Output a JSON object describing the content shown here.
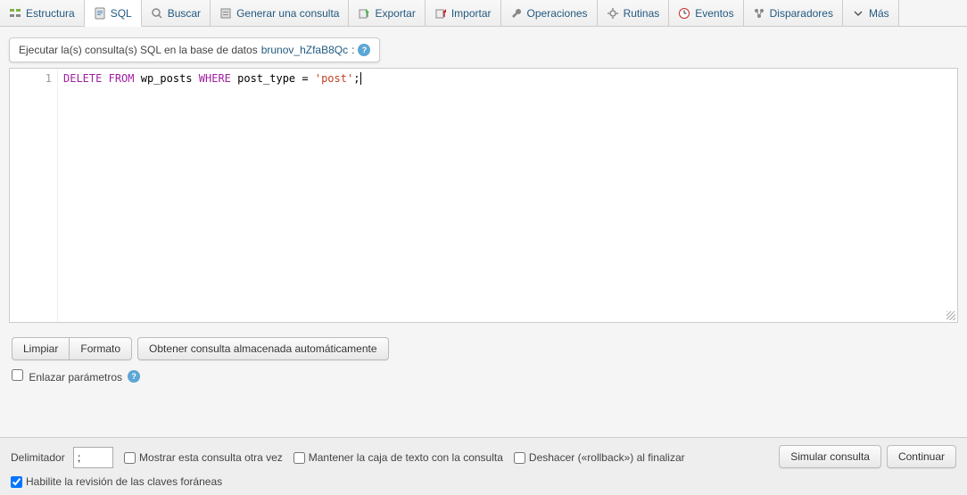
{
  "tabs": {
    "structure": "Estructura",
    "sql": "SQL",
    "search": "Buscar",
    "generate": "Generar una consulta",
    "export": "Exportar",
    "import": "Importar",
    "operations": "Operaciones",
    "routines": "Rutinas",
    "events": "Eventos",
    "triggers": "Disparadores",
    "more": "Más"
  },
  "header": {
    "prefix": "Ejecutar la(s) consulta(s) SQL en la base de datos ",
    "dbname": "brunov_hZfaB8Qc",
    "suffix": ":"
  },
  "editor": {
    "line_number": "1",
    "sql_kw1": "DELETE",
    "sql_kw2": "FROM",
    "sql_table": "wp_posts",
    "sql_kw3": "WHERE",
    "sql_col": "post_type",
    "sql_eq": "=",
    "sql_val": "'post'",
    "sql_semi": ";"
  },
  "buttons": {
    "clear": "Limpiar",
    "format": "Formato",
    "autosave": "Obtener consulta almacenada automáticamente"
  },
  "options": {
    "bind_params": "Enlazar parámetros"
  },
  "bottom": {
    "delimiter_label": "Delimitador",
    "delimiter_value": ";",
    "show_again": "Mostrar esta consulta otra vez",
    "keep_box": "Mantener la caja de texto con la consulta",
    "rollback": "Deshacer («rollback») al finalizar",
    "fk_check": "Habilite la revisión de las claves foráneas",
    "simulate": "Simular consulta",
    "go": "Continuar"
  }
}
